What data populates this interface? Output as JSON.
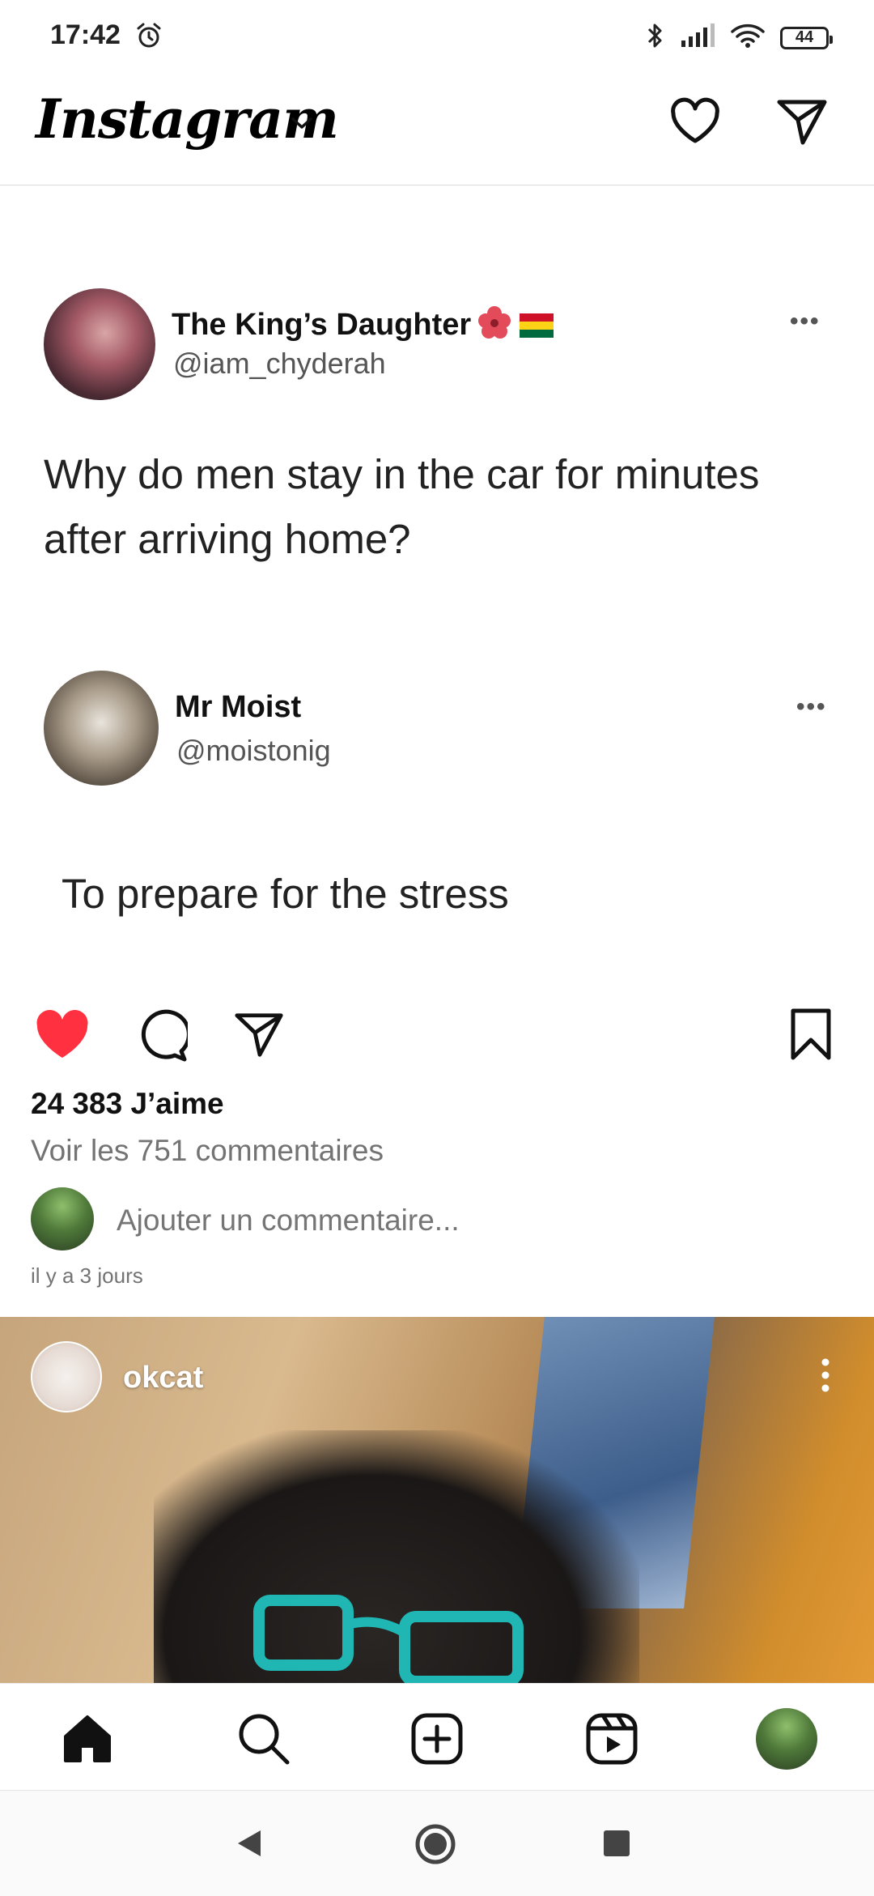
{
  "status_bar": {
    "time": "17:42",
    "battery": "44"
  },
  "header": {
    "logo": "Instagram"
  },
  "tweets": [
    {
      "name": "The King’s Daughter",
      "handle": "@iam_chyderah",
      "text": "Why do men stay in the car for minutes after arriving home?"
    },
    {
      "name": "Mr Moist",
      "handle": "@moistonig",
      "text": "To prepare for the stress"
    }
  ],
  "post": {
    "likes": "24 383 J’aime",
    "view_comments": "Voir les 751 commentaires",
    "comment_placeholder": "Ajouter un commentaire...",
    "timestamp": "il y a 3 jours",
    "liked": true
  },
  "next_post": {
    "username": "okcat"
  },
  "colors": {
    "like_red": "#ff3040",
    "muted_text": "#737373"
  },
  "icons": [
    "alarm-icon",
    "bluetooth-icon",
    "signal-icon",
    "wifi-icon",
    "battery-icon",
    "chevron-down-icon",
    "heart-icon",
    "send-icon",
    "more-icon",
    "comment-icon",
    "bookmark-icon",
    "home-icon",
    "search-icon",
    "add-icon",
    "reels-icon",
    "back-icon",
    "home-circle-icon",
    "recents-icon"
  ]
}
